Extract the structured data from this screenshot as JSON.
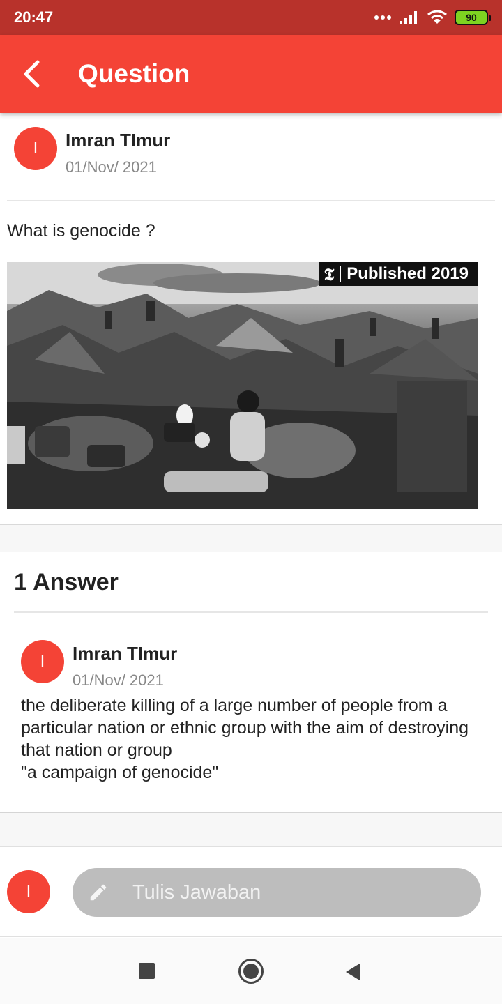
{
  "status_bar": {
    "time": "20:47",
    "battery": "90",
    "icons": [
      "dots-icon",
      "signal-icon",
      "wifi-icon",
      "battery-icon"
    ]
  },
  "app_bar": {
    "title": "Question",
    "back_icon": "chevron-left-icon",
    "color": "#f44336"
  },
  "question": {
    "author_initial": "I",
    "author_name": "Imran TImur",
    "date": "01/Nov/ 2021",
    "text": "What is genocide ?",
    "image_badge": "Published 2019",
    "image_badge_logo": "𝕿"
  },
  "answers": {
    "count_label": "1 Answer",
    "items": [
      {
        "author_initial": "I",
        "author_name": "Imran TImur",
        "date": "01/Nov/ 2021",
        "text": "the deliberate killing of a large number of people from a particular nation or ethnic group with the aim of destroying that nation or group\n\"a campaign of genocide\""
      }
    ]
  },
  "compose": {
    "avatar_initial": "I",
    "placeholder": "Tulis Jawaban",
    "icon": "pencil-icon"
  },
  "nav_bar": {
    "icons": [
      "recents-icon",
      "home-icon",
      "back-icon"
    ]
  },
  "colors": {
    "status_bar": "#b8322b",
    "accent": "#f44336",
    "input_bg": "#bdbdbd"
  }
}
